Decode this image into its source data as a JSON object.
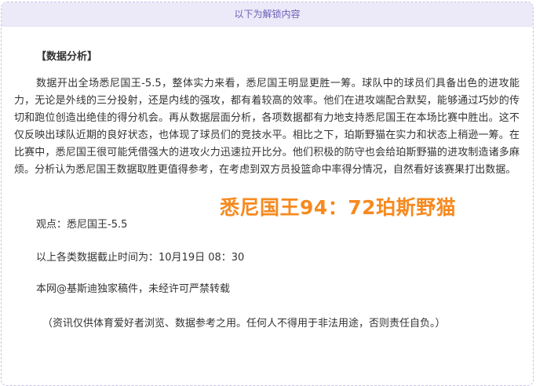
{
  "unlock_banner": "以下为解锁内容",
  "article": {
    "heading": "【数据分析】",
    "paragraph": "数据开出全场悉尼国王-5.5，整体实力来看，悉尼国王明显更胜一筹。球队中的球员们具备出色的进攻能力，无论是外线的三分投射，还是内线的强攻，都有着较高的效率。他们在进攻端配合默契，能够通过巧妙的传切和跑位创造出绝佳的得分机会。再从数据层面分析，各项数据都有力地支持悉尼国王在本场比赛中胜出。这不仅反映出球队近期的良好状态，也体现了球员们的竞技水平。相比之下，珀斯野猫在实力和状态上稍逊一筹。在比赛中，悉尼国王很可能凭借强大的进攻火力迅速拉开比分。他们积极的防守也会给珀斯野猫的进攻制造诸多麻烦。分析认为悉尼国王数据取胜更值得参考，在考虑到双方员投篮命中率得分情况，自然看好该赛果打出数据。",
    "score_overlay": "悉尼国王94：72珀斯野猫",
    "viewpoint": "观点：悉尼国王-5.5",
    "deadline": "以上各类数据截止时间为：10月19日 08：30",
    "copyright": "本网@基斯迪独家稿件，未经许可严禁转载",
    "disclaimer": "（资讯仅供体育爱好者浏览、数据参考之用。任何人不得用于非法用途，否则责任自负。）"
  },
  "colors": {
    "banner_bg": "#ece9f8",
    "banner_text": "#6a5fb8",
    "border": "#c8c3e6",
    "score_text": "#f68a1f",
    "body_text": "#333333"
  }
}
